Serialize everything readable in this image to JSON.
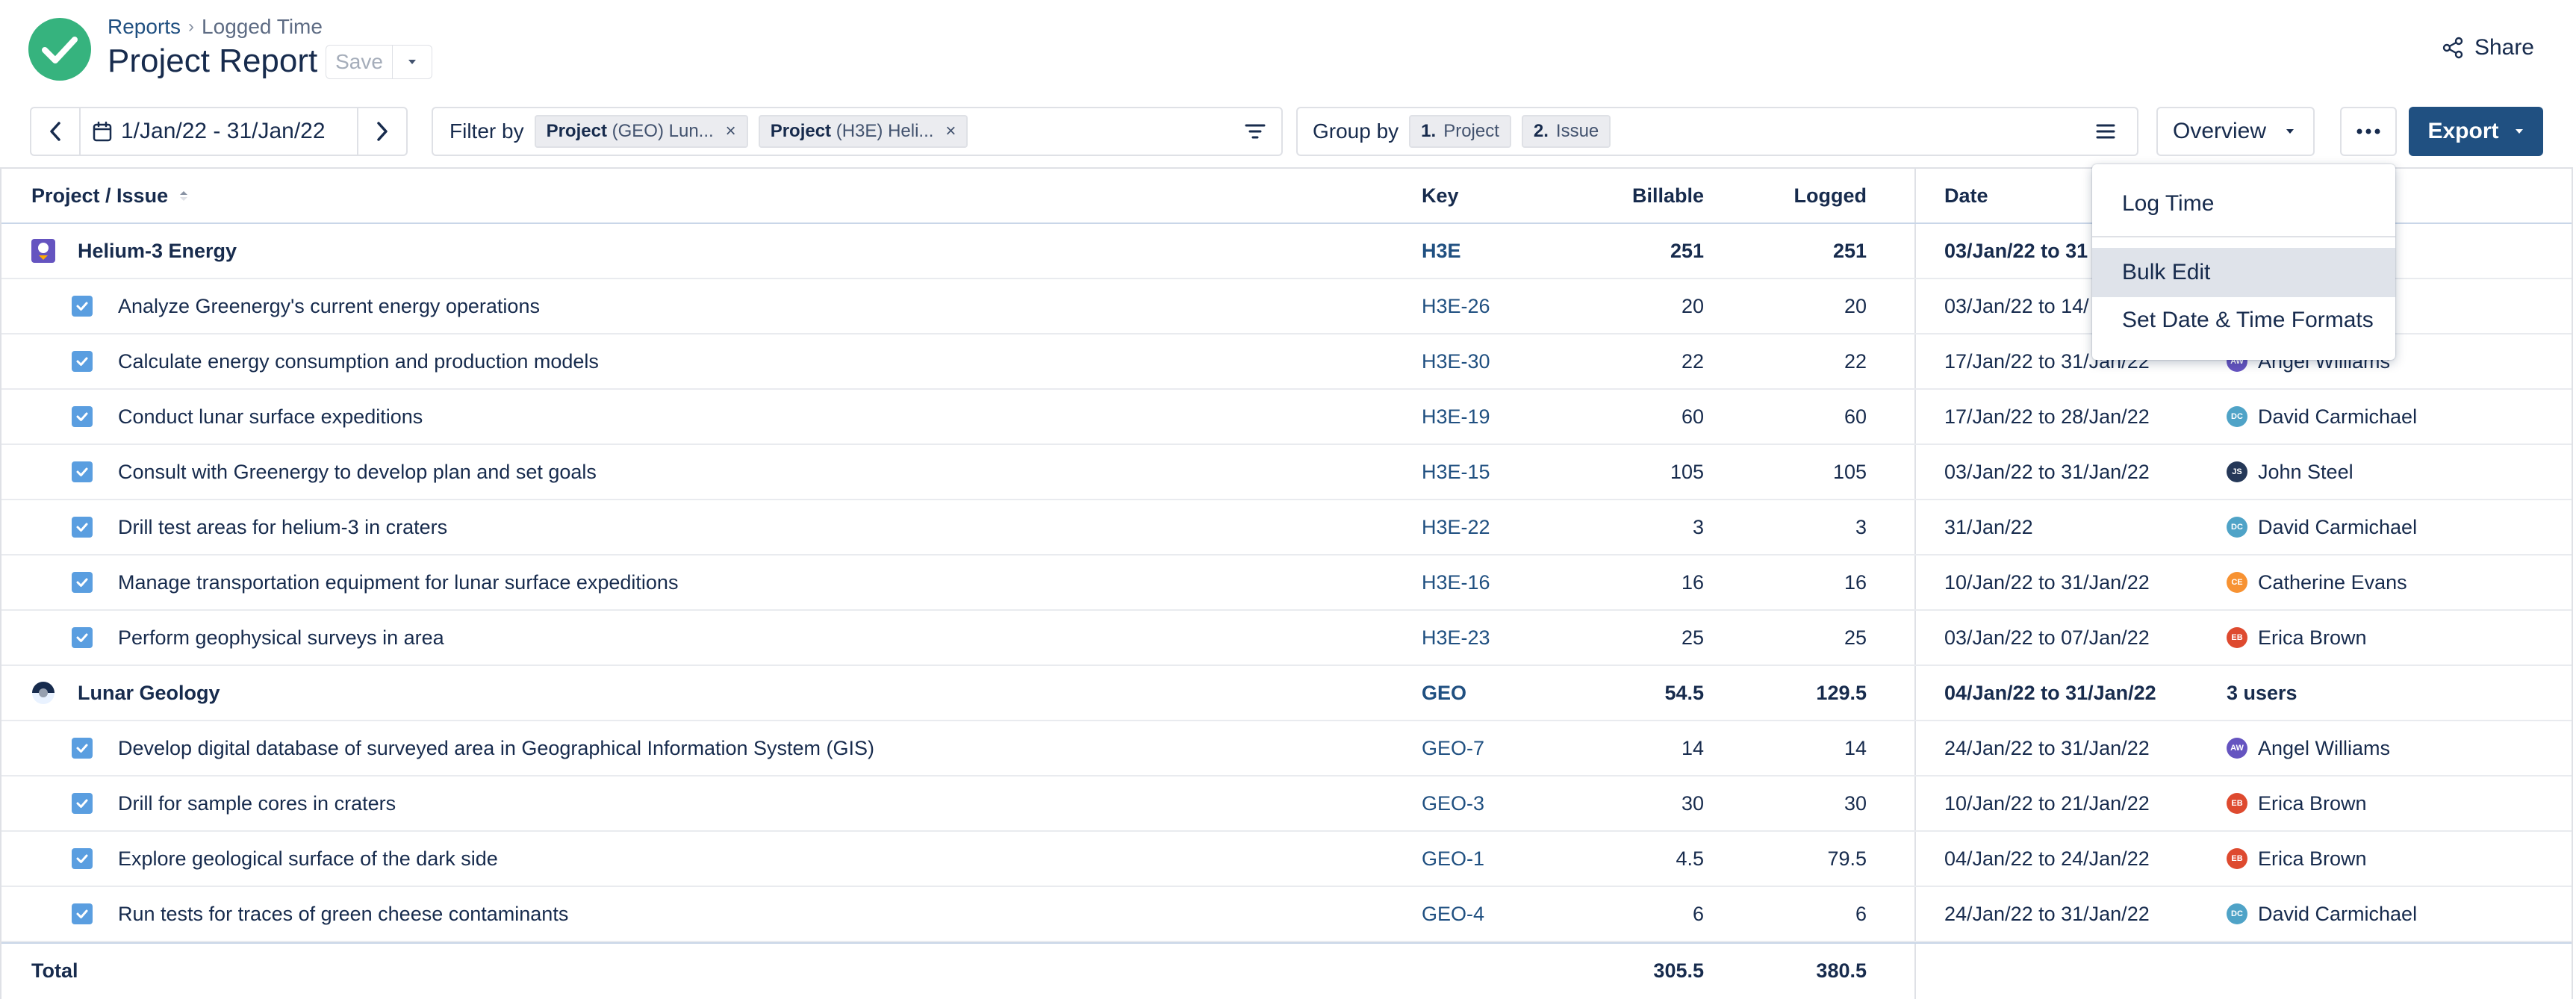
{
  "breadcrumb": {
    "parent": "Reports",
    "separator": "›",
    "current": "Logged Time"
  },
  "page": {
    "title": "Project Report",
    "save_label": "Save"
  },
  "header": {
    "share_label": "Share"
  },
  "toolbar": {
    "date_range": "1/Jan/22 - 31/Jan/22",
    "filter_label": "Filter by",
    "filter_chips": [
      {
        "field": "Project",
        "value": "(GEO) Lun..."
      },
      {
        "field": "Project",
        "value": "(H3E) Heli..."
      }
    ],
    "group_label": "Group by",
    "group_chips": [
      {
        "num": "1.",
        "label": "Project"
      },
      {
        "num": "2.",
        "label": "Issue"
      }
    ],
    "view_label": "Overview",
    "export_label": "Export"
  },
  "table": {
    "headers": {
      "name": "Project / Issue",
      "key": "Key",
      "billable": "Billable",
      "logged": "Logged",
      "date": "Date"
    },
    "groups": [
      {
        "name": "Helium-3 Energy",
        "key": "H3E",
        "billable": "251",
        "logged": "251",
        "date": "03/Jan/22 to 31",
        "users": "",
        "issues": [
          {
            "name": "Analyze Greenergy's current energy operations",
            "key": "H3E-26",
            "billable": "20",
            "logged": "20",
            "date": "03/Jan/22 to 14/",
            "user": "",
            "initials": ""
          },
          {
            "name": "Calculate energy consumption and production models",
            "key": "H3E-30",
            "billable": "22",
            "logged": "22",
            "date": "17/Jan/22 to 31/Jan/22",
            "user": "Angel Williams",
            "initials": "AW"
          },
          {
            "name": "Conduct lunar surface expeditions",
            "key": "H3E-19",
            "billable": "60",
            "logged": "60",
            "date": "17/Jan/22 to 28/Jan/22",
            "user": "David Carmichael",
            "initials": "DC"
          },
          {
            "name": "Consult with Greenergy to develop plan and set goals",
            "key": "H3E-15",
            "billable": "105",
            "logged": "105",
            "date": "03/Jan/22 to 31/Jan/22",
            "user": "John Steel",
            "initials": "JS"
          },
          {
            "name": "Drill test areas for helium-3 in craters",
            "key": "H3E-22",
            "billable": "3",
            "logged": "3",
            "date": "31/Jan/22",
            "user": "David Carmichael",
            "initials": "DC"
          },
          {
            "name": "Manage transportation equipment for lunar surface expeditions",
            "key": "H3E-16",
            "billable": "16",
            "logged": "16",
            "date": "10/Jan/22 to 31/Jan/22",
            "user": "Catherine Evans",
            "initials": "CE"
          },
          {
            "name": "Perform geophysical surveys in area",
            "key": "H3E-23",
            "billable": "25",
            "logged": "25",
            "date": "03/Jan/22 to 07/Jan/22",
            "user": "Erica Brown",
            "initials": "EB"
          }
        ]
      },
      {
        "name": "Lunar Geology",
        "key": "GEO",
        "billable": "54.5",
        "logged": "129.5",
        "date": "04/Jan/22 to 31/Jan/22",
        "users": "3 users",
        "issues": [
          {
            "name": "Develop digital database of surveyed area in Geographical Information System (GIS)",
            "key": "GEO-7",
            "billable": "14",
            "logged": "14",
            "date": "24/Jan/22 to 31/Jan/22",
            "user": "Angel Williams",
            "initials": "AW"
          },
          {
            "name": "Drill for sample cores in craters",
            "key": "GEO-3",
            "billable": "30",
            "logged": "30",
            "date": "10/Jan/22 to 21/Jan/22",
            "user": "Erica Brown",
            "initials": "EB"
          },
          {
            "name": "Explore geological surface of the dark side",
            "key": "GEO-1",
            "billable": "4.5",
            "logged": "79.5",
            "date": "04/Jan/22 to 24/Jan/22",
            "user": "Erica Brown",
            "initials": "EB"
          },
          {
            "name": "Run tests for traces of green cheese contaminants",
            "key": "GEO-4",
            "billable": "6",
            "logged": "6",
            "date": "24/Jan/22 to 31/Jan/22",
            "user": "David Carmichael",
            "initials": "DC"
          }
        ]
      }
    ],
    "total": {
      "label": "Total",
      "billable": "305.5",
      "logged": "380.5"
    }
  },
  "menu": {
    "items": [
      "Log Time",
      "Bulk Edit",
      "Set Date & Time Formats"
    ],
    "highlighted": "Bulk Edit"
  },
  "colors": {
    "accent": "#205081",
    "success": "#36b37e",
    "checkbox": "#5a9ee0",
    "avatars": {
      "AW": "#6554c0",
      "DC": "#4fa3c7",
      "JS": "#253858",
      "CE": "#f79232",
      "EB": "#de4a2f"
    }
  },
  "icons": {
    "logo": "check-circle-icon",
    "share": "share-icon",
    "calendar": "calendar-icon",
    "filter": "filter-icon",
    "group": "list-icon",
    "more": "more-icon",
    "sort": "sort-icon"
  }
}
